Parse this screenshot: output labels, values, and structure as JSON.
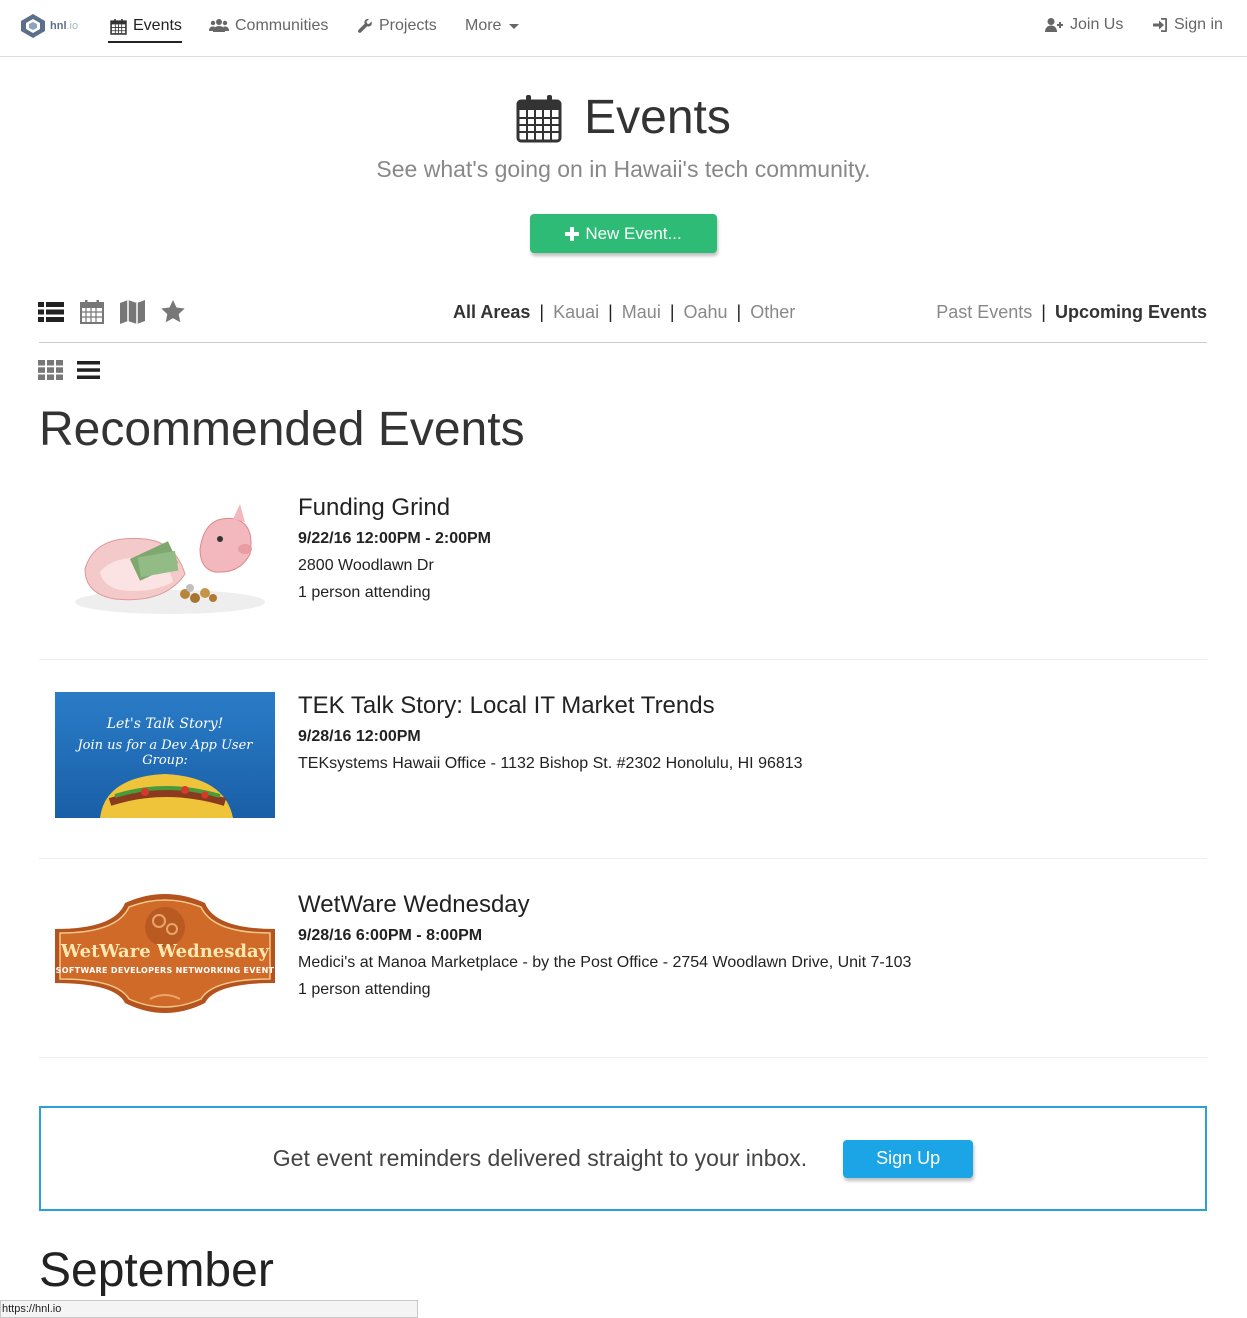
{
  "nav": {
    "brand": "hnl",
    "brand_suffix": ".io",
    "items": [
      {
        "label": "Events",
        "icon": "calendar-icon"
      },
      {
        "label": "Communities",
        "icon": "users-icon"
      },
      {
        "label": "Projects",
        "icon": "wrench-icon"
      },
      {
        "label": "More",
        "icon": "chevron-down-icon"
      }
    ],
    "right": [
      {
        "label": "Join Us",
        "icon": "user-plus-icon"
      },
      {
        "label": "Sign in",
        "icon": "sign-in-icon"
      }
    ]
  },
  "header": {
    "title": "Events",
    "subtitle": "See what's going on in Hawaii's tech community.",
    "new_button": "New Event..."
  },
  "filters": {
    "areas": [
      "All Areas",
      "Kauai",
      "Maui",
      "Oahu",
      "Other"
    ],
    "active_area": "All Areas",
    "timeframes": [
      "Past Events",
      "Upcoming Events"
    ],
    "active_timeframe": "Upcoming Events"
  },
  "recommended": {
    "title": "Recommended Events",
    "events": [
      {
        "title": "Funding Grind",
        "time": "9/22/16 12:00PM - 2:00PM",
        "location": "2800 Woodlawn Dr",
        "attending": "1 person attending"
      },
      {
        "title": "TEK Talk Story: Local IT Market Trends",
        "time": "9/28/16 12:00PM",
        "location": "TEKsystems Hawaii Office - 1132 Bishop St. #2302 Honolulu, HI 96813",
        "attending": "",
        "image_text_1": "Let's Talk Story!",
        "image_text_2": "Join us for a Dev App User Group:"
      },
      {
        "title": "WetWare Wednesday",
        "time": "9/28/16 6:00PM - 8:00PM",
        "location": "Medici's at Manoa Marketplace - by the Post Office - 2754 Woodlawn Drive, Unit 7-103",
        "attending": "1 person attending",
        "image_text_1": "WetWare Wednesday",
        "image_text_2": "SOFTWARE DEVELOPERS NETWORKING EVENT"
      }
    ]
  },
  "reminder": {
    "text": "Get event reminders delivered straight to your inbox.",
    "button": "Sign Up"
  },
  "month_heading": "September",
  "status_url": "https://hnl.io",
  "colors": {
    "new_button": "#2dbb75",
    "signup_button": "#1ba5e6",
    "reminder_border": "#2aa0d8"
  }
}
